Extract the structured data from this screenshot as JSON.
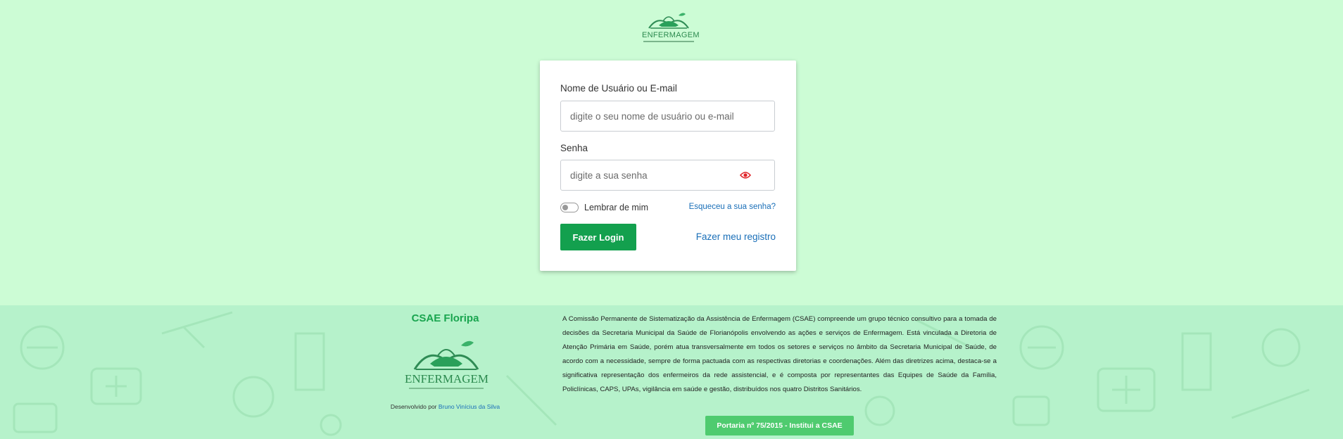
{
  "header": {
    "logo_text": "ENFERMAGEM"
  },
  "login": {
    "username_label": "Nome de Usuário ou E-mail",
    "username_placeholder": "digite o seu nome de usuário ou e-mail",
    "password_label": "Senha",
    "password_placeholder": "digite a sua senha",
    "remember_label": "Lembrar de mim",
    "forgot_link": "Esqueceu a sua senha?",
    "login_button": "Fazer Login",
    "register_link": "Fazer meu registro"
  },
  "footer": {
    "title": "CSAE Floripa",
    "logo_text": "ENFERMAGEM",
    "developed_by_prefix": "Desenvolvido por",
    "developer_name": "Bruno Vinícius da Silva",
    "description": "A Comissão Permanente de Sistematização da Assistência de Enfermagem (CSAE) compreende um grupo técnico consultivo para a tomada de decisões da Secretaria Municipal da Saúde de Florianópolis envolvendo as ações e serviços de Enfermagem. Está vinculada a Diretoria de Atenção Primária em Saúde, porém atua transversalmente em todos os setores e serviços no âmbito da Secretaria Municipal de Saúde, de acordo com a necessidade, sempre de forma pactuada com as respectivas diretorias e coordenações. Além das diretrizes acima, destaca-se a significativa representação dos enfermeiros da rede assistencial, e é composta por representantes das Equipes de Saúde da Família, Policlínicas, CAPS, UPAs, vigilância em saúde e gestão, distribuídos nos quatro Distritos Sanitários.",
    "portaria_button": "Portaria nº 75/2015 - Institui a CSAE"
  },
  "colors": {
    "page_bg": "#ccfcd5",
    "footer_bg": "#b6f2cb",
    "primary_button": "#13a04e",
    "link": "#1a6fb8",
    "eye_icon": "#e0262b",
    "footer_title": "#19a54f",
    "portaria_button": "#4fcb6f"
  },
  "icons": {
    "password_visibility": "eye-icon",
    "logo": "nursing-lamp-logo-icon"
  }
}
